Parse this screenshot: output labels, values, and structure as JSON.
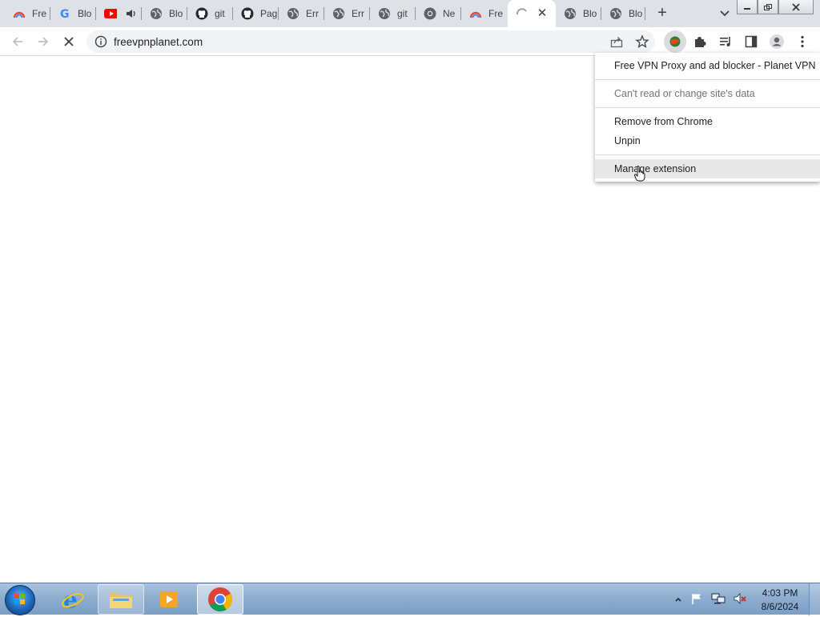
{
  "tabs": [
    {
      "label": "Fre",
      "icon": "rainbow-icon"
    },
    {
      "label": "Blo",
      "icon": "google-icon"
    },
    {
      "label": "",
      "icon": "youtube-icon",
      "audio": true
    },
    {
      "label": "Blo",
      "icon": "globe-icon"
    },
    {
      "label": "git",
      "icon": "github-icon"
    },
    {
      "label": "Pag",
      "icon": "github-icon"
    },
    {
      "label": "Err",
      "icon": "globe-icon"
    },
    {
      "label": "Err",
      "icon": "globe-icon"
    },
    {
      "label": "git",
      "icon": "globe-icon"
    },
    {
      "label": "Ne",
      "icon": "chrome-icon"
    },
    {
      "label": "Fre",
      "icon": "rainbow-icon"
    },
    {
      "label": "",
      "icon": "loading-spinner-icon",
      "active": true
    },
    {
      "label": "Blo",
      "icon": "globe-icon"
    },
    {
      "label": "Blo",
      "icon": "globe-icon"
    }
  ],
  "toolbar": {
    "url": "freevpnplanet.com"
  },
  "extension_menu": {
    "title": "Free VPN Proxy and ad blocker - Planet VPN",
    "permission": "Can't read or change site's data",
    "remove": "Remove from Chrome",
    "unpin": "Unpin",
    "manage": "Manage extension"
  },
  "taskbar": {
    "time": "4:03 PM",
    "date": "8/6/2024"
  },
  "colors": {
    "tabstrip": "#dee1e6",
    "omnibox": "#f1f3f4",
    "taskbar": "#8eaecf"
  }
}
